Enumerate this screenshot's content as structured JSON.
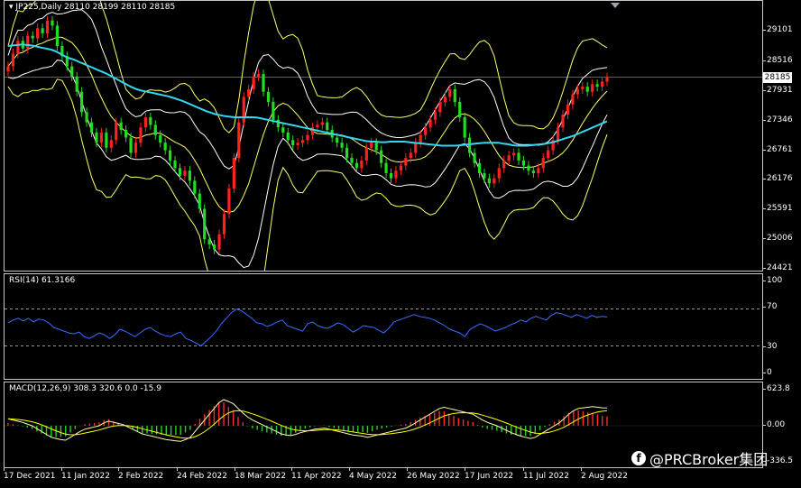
{
  "symbol_title": "JP225,Daily  28110 28199 28110 28185",
  "current_price_label": "28185",
  "price_axis": [
    "29101",
    "28516",
    "27931",
    "27346",
    "26761",
    "26176",
    "25591",
    "25006",
    "24421"
  ],
  "rsi": {
    "title": "RSI(14) 61.3166",
    "axis": [
      "100",
      "70",
      "30",
      "0"
    ],
    "level_high": 70,
    "level_low": 30
  },
  "macd": {
    "title": "MACD(12,26,9) 308.3 320.6 0.0 -15.9",
    "axis": [
      "623.8",
      "0.00",
      "-336.5"
    ]
  },
  "x_axis": [
    "17 Dec 2021",
    "11 Jan 2022",
    "2 Feb 2022",
    "24 Feb 2022",
    "18 Mar 2022",
    "11 Apr 2022",
    "4 May 2022",
    "26 May 2022",
    "17 Jun 2022",
    "11 Jul 2022",
    "2 Aug 2022"
  ],
  "watermark": "@PRCBroker集团",
  "watermark_icon": "facebook-icon",
  "colors": {
    "up": "#ff2222",
    "down": "#22dd22",
    "ma": "#33d7f0",
    "bands": "#ffff66",
    "bands_inner": "#ffffff",
    "rsi_line": "#3a6cff",
    "macd_line": "#ffffaa",
    "signal": "#ffff00"
  },
  "chart_data": {
    "type": "line",
    "title": "JP225,Daily",
    "ohlc_last": {
      "open": 28110,
      "high": 28199,
      "low": 28110,
      "close": 28185
    },
    "closes": [
      28400,
      28650,
      28900,
      28750,
      29000,
      28950,
      29150,
      29050,
      29300,
      29200,
      28800,
      28600,
      28400,
      28200,
      27900,
      27500,
      27300,
      27100,
      26900,
      27100,
      26800,
      26950,
      27300,
      27150,
      27000,
      26700,
      26900,
      27200,
      27400,
      27250,
      27050,
      26900,
      26750,
      26550,
      26400,
      26250,
      26350,
      26150,
      25900,
      25600,
      25000,
      24900,
      24800,
      25100,
      25500,
      26000,
      26600,
      27300,
      27800,
      27950,
      28200,
      28250,
      27900,
      27700,
      27350,
      27200,
      27100,
      26950,
      26850,
      26900,
      26950,
      27050,
      27200,
      27250,
      27300,
      27150,
      27000,
      26900,
      26800,
      26600,
      26500,
      26400,
      26550,
      26800,
      26900,
      26750,
      26500,
      26300,
      26200,
      26350,
      26450,
      26600,
      26700,
      26900,
      27050,
      27200,
      27350,
      27500,
      27700,
      27800,
      27950,
      27700,
      27400,
      27000,
      26700,
      26500,
      26300,
      26200,
      26100,
      26200,
      26400,
      26550,
      26650,
      26700,
      26550,
      26450,
      26350,
      26300,
      26400,
      26600,
      26750,
      26950,
      27200,
      27450,
      27650,
      27850,
      27950,
      28000,
      27900,
      28050,
      28000,
      28100,
      28185
    ],
    "ma": [
      28800,
      28810,
      28820,
      28830,
      28820,
      28810,
      28790,
      28770,
      28750,
      28730,
      28700,
      28650,
      28600,
      28560,
      28530,
      28490,
      28450,
      28410,
      28370,
      28330,
      28290,
      28250,
      28200,
      28150,
      28100,
      28050,
      28000,
      27960,
      27930,
      27910,
      27890,
      27870,
      27850,
      27830,
      27810,
      27780,
      27750,
      27720,
      27680,
      27640,
      27600,
      27560,
      27520,
      27490,
      27460,
      27440,
      27420,
      27410,
      27400,
      27400,
      27400,
      27400,
      27400,
      27390,
      27370,
      27350,
      27330,
      27310,
      27290,
      27270,
      27250,
      27230,
      27210,
      27190,
      27170,
      27150,
      27130,
      27110,
      27090,
      27070,
      27050,
      27030,
      27010,
      26990,
      26970,
      26950,
      26930,
      26920,
      26920,
      26910,
      26910,
      26920,
      26920,
      26920,
      26920,
      26910,
      26900,
      26890,
      26880,
      26870,
      26860,
      26850,
      26840,
      26840,
      26840,
      26840,
      26850,
      26860,
      26870,
      26880,
      26890,
      26900,
      26900,
      26900,
      26900,
      26880,
      26870,
      26850,
      26840,
      26840,
      26840,
      26850,
      26860,
      26870,
      26880,
      26900,
      26920,
      26950,
      26980,
      27010,
      27040,
      27080,
      27120,
      27160,
      27200,
      27240,
      27280,
      27320
    ],
    "rsi_values": [
      55,
      58,
      60,
      57,
      60,
      56,
      59,
      58,
      55,
      50,
      48,
      46,
      44,
      43,
      45,
      40,
      38,
      41,
      44,
      42,
      38,
      42,
      48,
      46,
      43,
      40,
      44,
      48,
      50,
      46,
      43,
      41,
      40,
      43,
      45,
      38,
      36,
      33,
      30,
      35,
      40,
      46,
      54,
      60,
      66,
      70,
      68,
      64,
      60,
      55,
      54,
      51,
      53,
      56,
      58,
      52,
      50,
      48,
      46,
      54,
      56,
      52,
      50,
      49,
      52,
      55,
      53,
      49,
      45,
      48,
      52,
      51,
      50,
      47,
      44,
      49,
      56,
      58,
      60,
      62,
      64,
      62,
      61,
      60,
      58,
      55,
      52,
      48,
      46,
      44,
      40,
      48,
      51,
      54,
      52,
      49,
      46,
      48,
      50,
      53,
      55,
      58,
      56,
      60,
      62,
      60,
      58,
      63,
      66,
      65,
      63,
      61,
      64,
      62,
      60,
      63,
      61,
      62,
      61.3
    ],
    "macd_values": [
      120,
      100,
      80,
      60,
      30,
      0,
      -50,
      -100,
      -150,
      -200,
      -220,
      -240,
      -250,
      -200,
      -150,
      -100,
      -60,
      -40,
      -20,
      0,
      50,
      80,
      60,
      40,
      20,
      -20,
      -60,
      -100,
      -140,
      -160,
      -180,
      -200,
      -220,
      -240,
      -250,
      -260,
      -270,
      -240,
      -200,
      -100,
      0,
      100,
      200,
      300,
      400,
      450,
      420,
      380,
      300,
      220,
      150,
      100,
      60,
      20,
      -20,
      -60,
      -100,
      -140,
      -160,
      -170,
      -150,
      -120,
      -100,
      -80,
      -60,
      -50,
      -40,
      -60,
      -80,
      -100,
      -120,
      -140,
      -160,
      -170,
      -180,
      -200,
      -180,
      -160,
      -140,
      -120,
      -100,
      -80,
      -60,
      -40,
      0,
      50,
      100,
      150,
      200,
      250,
      300,
      320,
      300,
      280,
      260,
      240,
      220,
      200,
      150,
      100,
      60,
      30,
      0,
      -40,
      -80,
      -120,
      -150,
      -180,
      -200,
      -220,
      -200,
      -150,
      -100,
      -50,
      0,
      50,
      120,
      200,
      260,
      300,
      310,
      320,
      330,
      320,
      310,
      308
    ],
    "ylim": [
      24421,
      29500
    ]
  }
}
